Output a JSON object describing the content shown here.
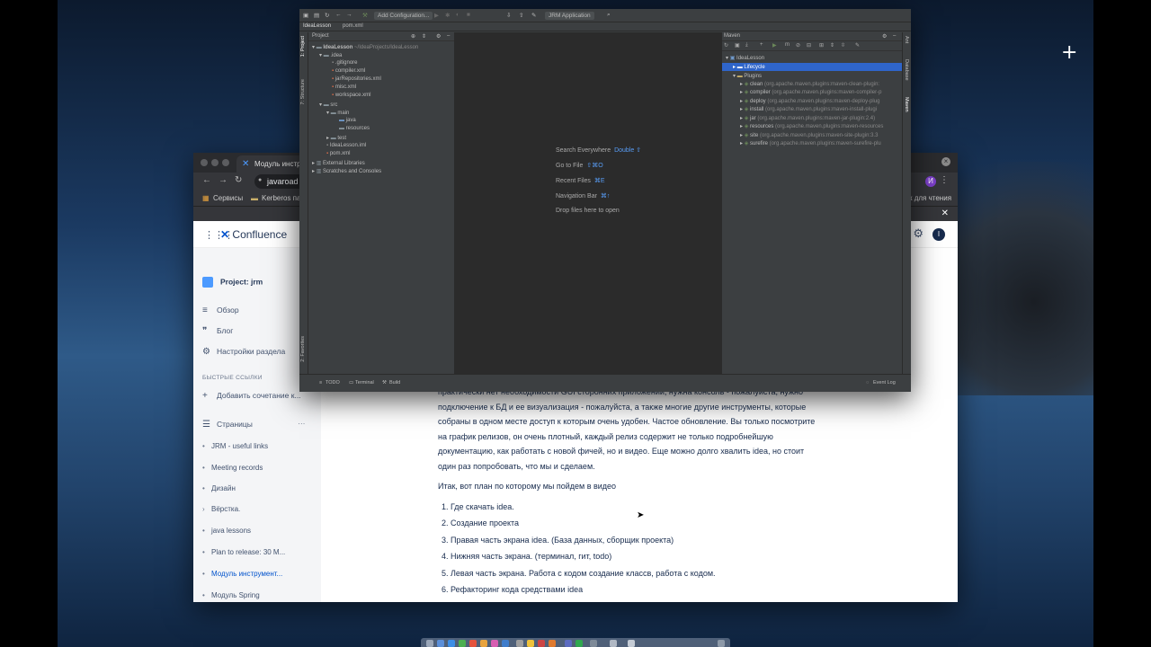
{
  "browser": {
    "tab_title": "Модуль инстру",
    "url": "javaroad",
    "bookmarks": {
      "services": "Сервисы",
      "kerberos": "Kerberos па",
      "reading_list": "к для чтения"
    },
    "profile_initial": "И"
  },
  "confluence": {
    "brand": "Confluence",
    "user_initial": "I",
    "sidebar": {
      "project": "Project: jrm",
      "overview": "Обзор",
      "blog": "Блог",
      "space_settings": "Настройки раздела",
      "quick_links_heading": "БЫСТРЫЕ ССЫЛКИ",
      "add_shortcut": "Добавить сочетание к...",
      "pages_heading": "Страницы",
      "more": "···",
      "pages": [
        "JRM - useful links",
        "Meeting records",
        "Дизайн",
        "Вёрстка.",
        "java lessons",
        "Plan to release: 30 M...",
        "Модуль инструмент...",
        "Модуль Spring"
      ]
    },
    "article": {
      "para1_line1": "практически нет необходимости GUI сторонних приложений, нужна консоль - пожалуйста, нужно",
      "para1_line2": "подключение к БД и ее визуализация - пожалуйста, а также многие другие инструменты, которые",
      "para1_line3": "собраны в одном месте доступ к которым очень удобен. Частое обновление. Вы только посмотрите",
      "para1_line4": "на график релизов, он очень плотный, каждый релиз содержит не только подробнейшую",
      "para1_line5": "документацию, как работать с новой фичей, но и видео. Еще можно долго хвалить idea, но стоит",
      "para1_line6": "один раз попробовать, что мы и сделаем.",
      "para2": "Итак, вот план по которому мы пойдем в видео",
      "list": [
        "1. Где скачать idea.",
        "2. Создание проекта",
        "3. Правая часть экрана idea. (База данных, сборщик проекта)",
        "4.  Нижняя часть экрана. (терминал, гит, todo)",
        "5. Левая часть экрана. Работа с кодом создание классв, работа с кодом.",
        "6. Рефакторинг кода средствами idea"
      ]
    }
  },
  "idea": {
    "toolbar": {
      "add_config": "Add Configuration...",
      "run_config": "JRM Application"
    },
    "breadcrumb": {
      "project": "IdeaLesson",
      "file": "pom.xml"
    },
    "project_panel": {
      "title": "Project",
      "tree": [
        {
          "label": "IdeaLesson",
          "path": "~/IdeaProjects/IdeaLesson"
        },
        {
          "label": ".idea"
        },
        {
          "label": ".gitignore"
        },
        {
          "label": "compiler.xml"
        },
        {
          "label": "jarRepositories.xml"
        },
        {
          "label": "misc.xml"
        },
        {
          "label": "workspace.xml"
        },
        {
          "label": "src"
        },
        {
          "label": "main"
        },
        {
          "label": "java"
        },
        {
          "label": "resources"
        },
        {
          "label": "test"
        },
        {
          "label": "IdeaLesson.iml"
        },
        {
          "label": "pom.xml"
        },
        {
          "label": "External Libraries"
        },
        {
          "label": "Scratches and Consoles"
        }
      ]
    },
    "editor_hints": [
      {
        "label": "Search Everywhere",
        "key": "Double ⇧"
      },
      {
        "label": "Go to File",
        "key": "⇧⌘O"
      },
      {
        "label": "Recent Files",
        "key": "⌘E"
      },
      {
        "label": "Navigation Bar",
        "key": "⌘↑"
      },
      {
        "label": "Drop files here to open",
        "key": ""
      }
    ],
    "maven": {
      "title": "Maven",
      "root": "IdeaLesson",
      "lifecycle": "Lifecycle",
      "plugins": "Plugins",
      "items": [
        {
          "name": "clean",
          "coord": "(org.apache.maven.plugins:maven-clean-plugin:"
        },
        {
          "name": "compiler",
          "coord": "(org.apache.maven.plugins:maven-compiler-p"
        },
        {
          "name": "deploy",
          "coord": "(org.apache.maven.plugins:maven-deploy-plug"
        },
        {
          "name": "install",
          "coord": "(org.apache.maven.plugins:maven-install-plugi"
        },
        {
          "name": "jar",
          "coord": "(org.apache.maven.plugins:maven-jar-plugin:2.4)"
        },
        {
          "name": "resources",
          "coord": "(org.apache.maven.plugins:maven-resources"
        },
        {
          "name": "site",
          "coord": "(org.apache.maven.plugins:maven-site-plugin:3.3"
        },
        {
          "name": "surefire",
          "coord": "(org.apache.maven.plugins:maven-surefire-plu"
        }
      ]
    },
    "left_tabs": {
      "project": "1: Project",
      "structure": "7: Structure",
      "favorites": "2: Favorites"
    },
    "right_tabs": {
      "ant": "Ant",
      "database": "Database",
      "maven": "Maven"
    },
    "bottom_tabs": {
      "todo": "TODO",
      "terminal": "Terminal",
      "build": "Build",
      "event_log": "Event Log"
    }
  }
}
